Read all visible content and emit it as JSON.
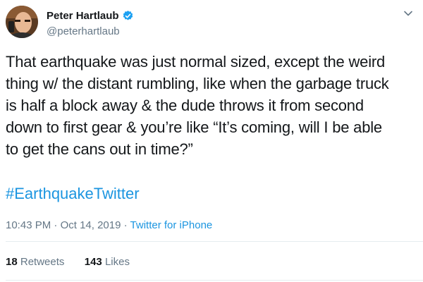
{
  "author": {
    "display_name": "Peter Hartlaub",
    "handle": "@peterhartlaub",
    "verified": true,
    "avatar_icon": "avatar-photo"
  },
  "tweet": {
    "text_lines": [
      "That earthquake was just normal sized, except the weird",
      "thing w/ the distant rumbling, like when the garbage truck",
      "is half a block away & the dude throws it from second",
      "down to first gear & you’re like “It’s coming, will I be able",
      "to get the cans out in time?”"
    ],
    "hashtag": "#EarthquakeTwitter",
    "time": "10:43 PM",
    "date": "Oct 14, 2019",
    "separator": " · ",
    "source": "Twitter for iPhone"
  },
  "stats": {
    "retweets_count": "18",
    "retweets_label": "Retweets",
    "likes_count": "143",
    "likes_label": "Likes"
  },
  "colors": {
    "link": "#1b95e0",
    "muted": "#657786",
    "text": "#14171a"
  }
}
